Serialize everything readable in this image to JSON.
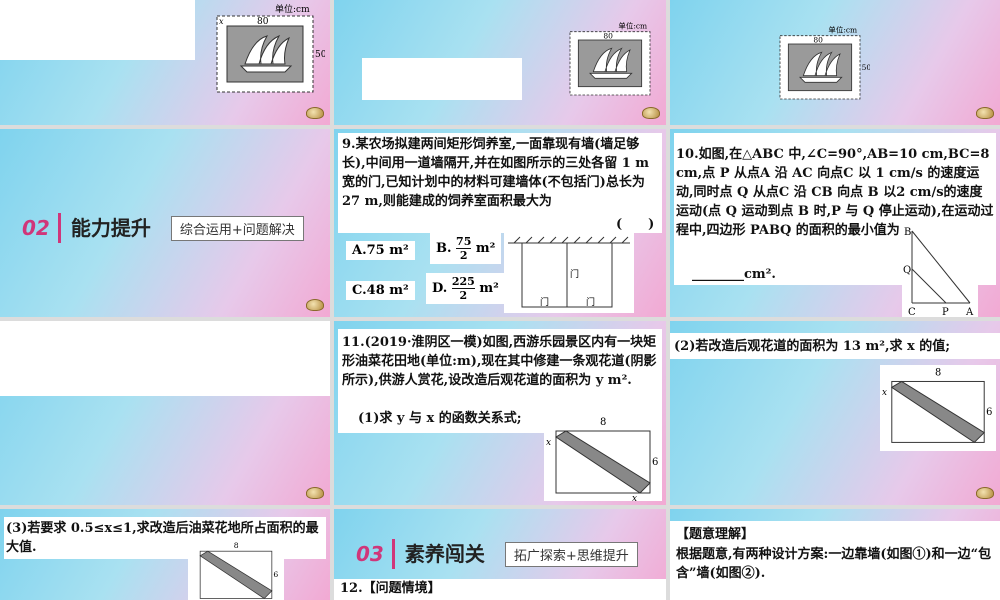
{
  "unit_label": "单位:cm",
  "dim_80": "80",
  "dim_50": "50",
  "dim_x": "x",
  "section2": {
    "num": "02",
    "title": "能力提升",
    "sub": "综合运用+问题解决"
  },
  "section3": {
    "num": "03",
    "title": "素养闯关",
    "sub": "拓广探索+思维提升"
  },
  "q9": {
    "text": "9.某农场拟建两间矩形饲养室,一面靠现有墙(墙足够长),中间用一道墙隔开,并在如图所示的三处各留 1 m 宽的门,已知计划中的材料可建墙体(不包括门)总长为 27 m,则能建成的饲养室面积最大为",
    "paren": "(　　)",
    "optA": "A.75 m²",
    "optB_letter": "B.",
    "optB_num": "75",
    "optB_den": "2",
    "optB_unit": "m²",
    "optC": "C.48 m²",
    "optD_letter": "D.",
    "optD_num": "225",
    "optD_den": "2",
    "optD_unit": "m²",
    "door": "门"
  },
  "q10": {
    "text1": "10.如图,在△ABC 中,∠C=90°,AB=10 cm,BC=8 cm,点 P 从点A 沿 AC 向点C 以 1 cm/s 的速度运动,同时点 Q 从点C 沿 CB 向点 B 以2 cm/s的速度运动(点 Q 运动到点 B 时,P 与 Q 停止运动),在运动过程中,四边形 PABQ 的面积的最小值为",
    "blank": "________cm².",
    "B": "B",
    "Q": "Q",
    "C": "C",
    "P": "P",
    "A": "A"
  },
  "q11": {
    "text": "11.(2019·淮阴区一模)如图,西游乐园景区内有一块矩形油菜花田地(单位:m),现在其中修建一条观花道(阴影所示),供游人赏花,设改造后观花道的面积为 y m².",
    "sub1": "(1)求 y 与 x 的函数关系式;",
    "dim8": "8",
    "dim6": "6",
    "x": "x"
  },
  "q11_2": {
    "text": "(2)若改造后观花道的面积为 13 m²,求 x 的值;"
  },
  "q11_3": {
    "text": "(3)若要求 0.5≤x≤1,求改造后油菜花地所占面积的最大值."
  },
  "q12": {
    "label": "12.【问题情境】"
  },
  "analysis": {
    "title": "【题意理解】",
    "text": "根据题意,有两种设计方案:一边靠墙(如图①)和一边“包含”墙(如图②)."
  }
}
